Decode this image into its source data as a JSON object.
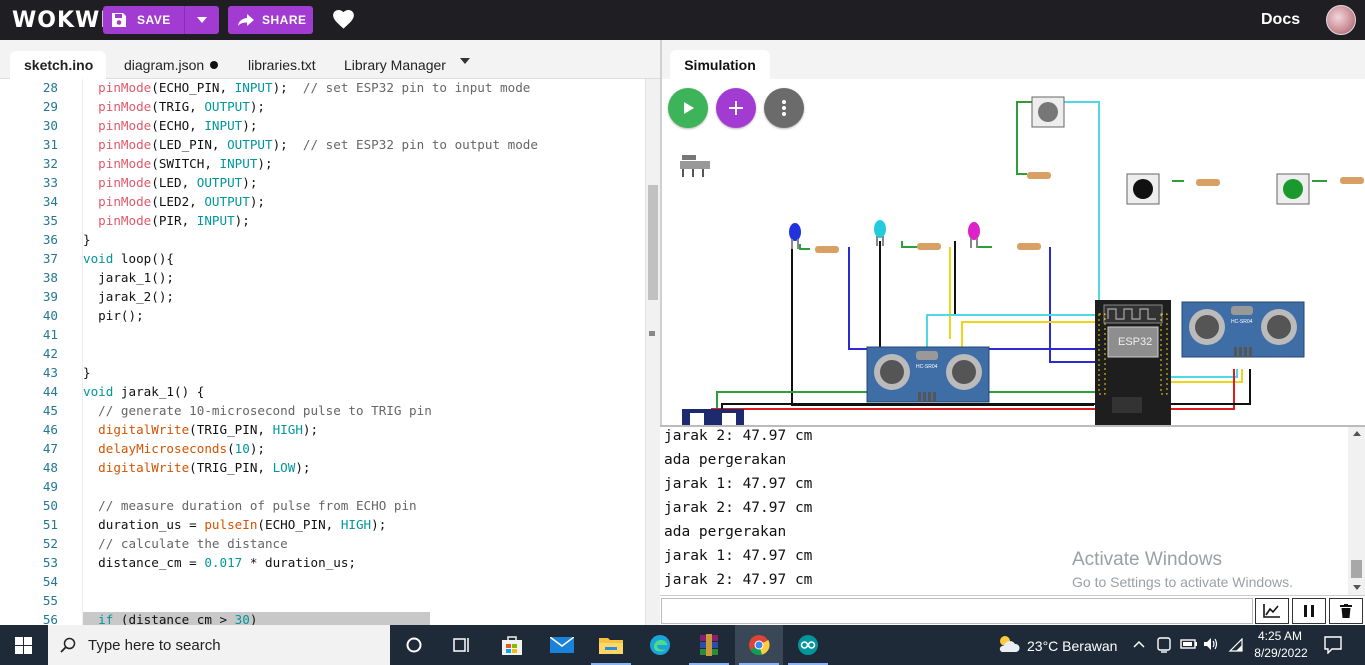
{
  "topbar": {
    "logo": "WOKWI",
    "save_label": "SAVE",
    "share_label": "SHARE",
    "docs_label": "Docs"
  },
  "editor": {
    "tabs": [
      {
        "label": "sketch.ino"
      },
      {
        "label": "diagram.json"
      },
      {
        "label": "libraries.txt"
      },
      {
        "label": "Library Manager"
      }
    ],
    "lines": [
      {
        "n": "28",
        "segs": [
          {
            "t": "  "
          },
          {
            "t": "pinMode",
            "c": "pm"
          },
          {
            "t": "(ECHO_PIN, "
          },
          {
            "t": "INPUT",
            "c": "cn"
          },
          {
            "t": ");  "
          },
          {
            "t": "// set ESP32 pin to input mode",
            "c": "cm"
          }
        ]
      },
      {
        "n": "29",
        "segs": [
          {
            "t": "  "
          },
          {
            "t": "pinMode",
            "c": "pm"
          },
          {
            "t": "(TRIG, "
          },
          {
            "t": "OUTPUT",
            "c": "cn"
          },
          {
            "t": ");"
          }
        ]
      },
      {
        "n": "30",
        "segs": [
          {
            "t": "  "
          },
          {
            "t": "pinMode",
            "c": "pm"
          },
          {
            "t": "(ECHO, "
          },
          {
            "t": "INPUT",
            "c": "cn"
          },
          {
            "t": ");"
          }
        ]
      },
      {
        "n": "31",
        "segs": [
          {
            "t": "  "
          },
          {
            "t": "pinMode",
            "c": "pm"
          },
          {
            "t": "(LED_PIN, "
          },
          {
            "t": "OUTPUT",
            "c": "cn"
          },
          {
            "t": ");  "
          },
          {
            "t": "// set ESP32 pin to output mode",
            "c": "cm"
          }
        ]
      },
      {
        "n": "32",
        "segs": [
          {
            "t": "  "
          },
          {
            "t": "pinMode",
            "c": "pm"
          },
          {
            "t": "(SWITCH, "
          },
          {
            "t": "INPUT",
            "c": "cn"
          },
          {
            "t": ");"
          }
        ]
      },
      {
        "n": "33",
        "segs": [
          {
            "t": "  "
          },
          {
            "t": "pinMode",
            "c": "pm"
          },
          {
            "t": "(LED, "
          },
          {
            "t": "OUTPUT",
            "c": "cn"
          },
          {
            "t": ");"
          }
        ]
      },
      {
        "n": "34",
        "segs": [
          {
            "t": "  "
          },
          {
            "t": "pinMode",
            "c": "pm"
          },
          {
            "t": "(LED2, "
          },
          {
            "t": "OUTPUT",
            "c": "cn"
          },
          {
            "t": ");"
          }
        ]
      },
      {
        "n": "35",
        "segs": [
          {
            "t": "  "
          },
          {
            "t": "pinMode",
            "c": "pm"
          },
          {
            "t": "(PIR, "
          },
          {
            "t": "INPUT",
            "c": "cn"
          },
          {
            "t": ");"
          }
        ]
      },
      {
        "n": "36",
        "segs": [
          {
            "t": "}"
          }
        ]
      },
      {
        "n": "37",
        "segs": [
          {
            "t": "void",
            "c": "kw"
          },
          {
            "t": " loop(){"
          }
        ]
      },
      {
        "n": "38",
        "segs": [
          {
            "t": "  jarak_1();"
          }
        ]
      },
      {
        "n": "39",
        "segs": [
          {
            "t": "  jarak_2();"
          }
        ]
      },
      {
        "n": "40",
        "segs": [
          {
            "t": "  pir();"
          }
        ]
      },
      {
        "n": "41",
        "segs": []
      },
      {
        "n": "42",
        "segs": []
      },
      {
        "n": "43",
        "segs": [
          {
            "t": "}"
          }
        ]
      },
      {
        "n": "44",
        "segs": [
          {
            "t": "void",
            "c": "kw"
          },
          {
            "t": " jarak_1() {"
          }
        ]
      },
      {
        "n": "45",
        "segs": [
          {
            "t": "  "
          },
          {
            "t": "// generate 10-microsecond pulse to TRIG pin",
            "c": "cm"
          }
        ]
      },
      {
        "n": "46",
        "segs": [
          {
            "t": "  "
          },
          {
            "t": "digitalWrite",
            "c": "fn"
          },
          {
            "t": "(TRIG_PIN, "
          },
          {
            "t": "HIGH",
            "c": "cn"
          },
          {
            "t": ");"
          }
        ]
      },
      {
        "n": "47",
        "segs": [
          {
            "t": "  "
          },
          {
            "t": "delayMicroseconds",
            "c": "fn"
          },
          {
            "t": "("
          },
          {
            "t": "10",
            "c": "cn"
          },
          {
            "t": ");"
          }
        ]
      },
      {
        "n": "48",
        "segs": [
          {
            "t": "  "
          },
          {
            "t": "digitalWrite",
            "c": "fn"
          },
          {
            "t": "(TRIG_PIN, "
          },
          {
            "t": "LOW",
            "c": "cn"
          },
          {
            "t": ");"
          }
        ]
      },
      {
        "n": "49",
        "segs": []
      },
      {
        "n": "50",
        "segs": [
          {
            "t": "  "
          },
          {
            "t": "// measure duration of pulse from ECHO pin",
            "c": "cm"
          }
        ]
      },
      {
        "n": "51",
        "segs": [
          {
            "t": "  duration_us = "
          },
          {
            "t": "pulseIn",
            "c": "fn"
          },
          {
            "t": "(ECHO_PIN, "
          },
          {
            "t": "HIGH",
            "c": "cn"
          },
          {
            "t": ");"
          }
        ]
      },
      {
        "n": "52",
        "segs": [
          {
            "t": "  "
          },
          {
            "t": "// calculate the distance",
            "c": "cm"
          }
        ]
      },
      {
        "n": "53",
        "segs": [
          {
            "t": "  distance_cm = "
          },
          {
            "t": "0.017",
            "c": "cn"
          },
          {
            "t": " * duration_us;"
          }
        ]
      },
      {
        "n": "54",
        "segs": []
      },
      {
        "n": "55",
        "segs": []
      },
      {
        "n": "56",
        "segs": [
          {
            "t": "  "
          },
          {
            "t": "if",
            "c": "kw"
          },
          {
            "t": " (distance_cm > "
          },
          {
            "t": "30",
            "c": "cn"
          },
          {
            "t": ")"
          }
        ]
      }
    ]
  },
  "simulation": {
    "tab_label": "Simulation",
    "esp32_label": "ESP32",
    "sensor_label": "HC-SR04"
  },
  "serial": {
    "lines": [
      "jarak 2: 47.97 cm",
      "ada pergerakan",
      "jarak 1: 47.97 cm",
      "jarak 2: 47.97 cm",
      "ada pergerakan",
      "jarak 1: 47.97 cm",
      "jarak 2: 47.97 cm"
    ],
    "activate_title": "Activate Windows",
    "activate_sub": "Go to Settings to activate Windows."
  },
  "taskbar": {
    "search_placeholder": "Type here to search",
    "weather": "23°C  Berawan",
    "time": "4:25 AM",
    "date": "8/29/2022"
  },
  "colors": {
    "topbar": "#1f1f23",
    "accent": "#a13bd1",
    "play": "#3db35a",
    "taskbar": "#1e2a38"
  }
}
